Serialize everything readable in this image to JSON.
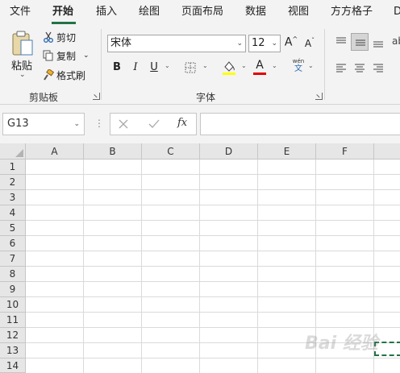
{
  "tabs": [
    {
      "label": "文件",
      "active": false
    },
    {
      "label": "开始",
      "active": true
    },
    {
      "label": "插入",
      "active": false
    },
    {
      "label": "绘图",
      "active": false
    },
    {
      "label": "页面布局",
      "active": false
    },
    {
      "label": "数据",
      "active": false
    },
    {
      "label": "视图",
      "active": false
    },
    {
      "label": "方方格子",
      "active": false
    },
    {
      "label": "D",
      "active": false
    }
  ],
  "clipboard": {
    "paste": "粘贴",
    "cut": "剪切",
    "copy": "复制",
    "format_painter": "格式刷",
    "group_label": "剪贴板"
  },
  "font": {
    "name": "宋体",
    "size": "12",
    "grow": "A",
    "shrink": "A",
    "bold": "B",
    "italic": "I",
    "underline": "U",
    "font_color_letter": "A",
    "phonetic_top": "wén",
    "phonetic_bottom": "文",
    "group_label": "字体",
    "highlight_color": "#ffff00",
    "font_color": "#e00000"
  },
  "formula_bar": {
    "name_box": "G13",
    "fx": "fx",
    "value": ""
  },
  "columns": [
    "A",
    "B",
    "C",
    "D",
    "E",
    "F"
  ],
  "rows": [
    "1",
    "2",
    "3",
    "4",
    "5",
    "6",
    "7",
    "8",
    "9",
    "10",
    "11",
    "12",
    "13",
    "14"
  ],
  "selected_cell": "G13",
  "watermark": "Bai 经验",
  "colors": {
    "accent": "#217346",
    "ribbon_bg": "#f3f3f3",
    "header_bg": "#e6e6e6"
  }
}
